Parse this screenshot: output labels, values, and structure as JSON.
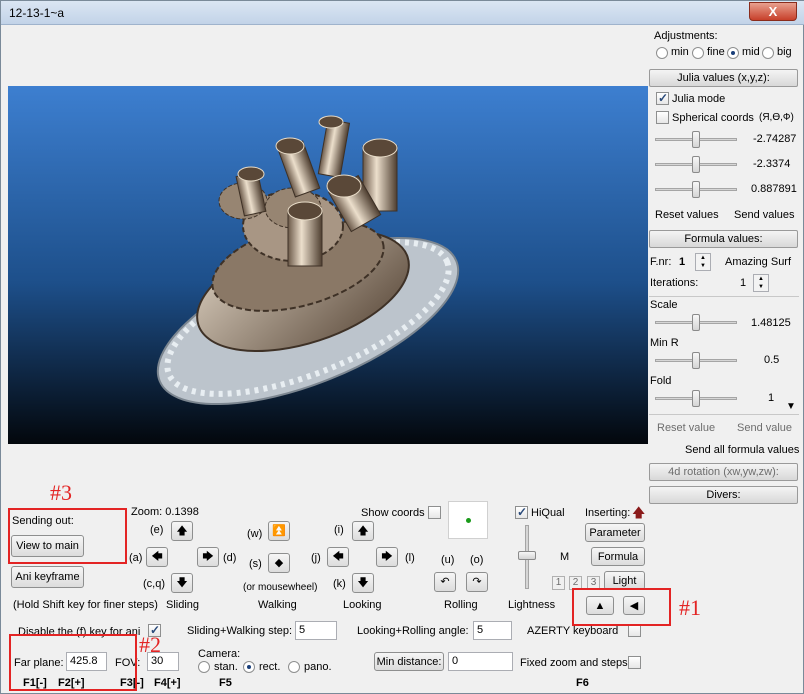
{
  "window": {
    "title": "12-13-1~a",
    "close": "X"
  },
  "adjust": {
    "label": "Adjustments:",
    "options": [
      "min",
      "fine",
      "mid",
      "big"
    ],
    "selected": "mid"
  },
  "julia": {
    "header": "Julia values (x,y,z):",
    "mode": "Julia mode",
    "spherical": "Spherical coords",
    "spherical_sym": "(Я,Ө,Ф)",
    "v1": "-2.74287",
    "v2": "-2.3374",
    "v3": "0.887891",
    "reset": "Reset values",
    "send": "Send values"
  },
  "formula": {
    "header": "Formula values:",
    "fnr_label": "F.nr:",
    "fnr": "1",
    "name": "Amazing Surf",
    "iter_label": "Iterations:",
    "iter": "1",
    "scale_label": "Scale",
    "scale": "1.48125",
    "minr_label": "Min R",
    "minr": "0.5",
    "fold_label": "Fold",
    "fold": "1",
    "reset": "Reset value",
    "send": "Send value",
    "send_all": "Send all formula values"
  },
  "rot4d": "4d rotation (xw,yw,zw):",
  "divers": "Divers:",
  "nav": {
    "zoom": "Zoom: 0.1398",
    "show_coords": "Show coords",
    "hiqual": "HiQual",
    "inserting": "Inserting:",
    "parameter": "Parameter",
    "formula": "Formula",
    "light": "Light",
    "m": "M",
    "n1": "1",
    "n2": "2",
    "n3": "3",
    "sending": "Sending out:",
    "view_main": "View to main",
    "ani": "Ani keyframe",
    "shift_hint": "(Hold Shift key for finer steps)",
    "k_e": "(e)",
    "k_a": "(a)",
    "k_d": "(d)",
    "k_cq": "(c,q)",
    "k_w": "(w)",
    "k_s": "(s)",
    "k_mw": "(or mousewheel)",
    "k_i": "(i)",
    "k_j": "(j)",
    "k_l": "(l)",
    "k_k": "(k)",
    "k_u": "(u)",
    "k_o": "(o)",
    "sliding": "Sliding",
    "walking": "Walking",
    "looking": "Looking",
    "rolling": "Rolling",
    "lightness": "Lightness"
  },
  "bottom": {
    "disable": "Disable the (f) key for ani",
    "sw_step": "Sliding+Walking step:",
    "sw_val": "5",
    "lr_angle": "Looking+Rolling angle:",
    "lr_val": "5",
    "azerty": "AZERTY keyboard",
    "far_plane": "Far plane:",
    "far_val": "425.8",
    "fov": "FOV:",
    "fov_val": "30",
    "camera": "Camera:",
    "stan": "stan.",
    "rect": "rect.",
    "pano": "pano.",
    "min_dist": "Min distance:",
    "min_val": "0",
    "fixed": "Fixed zoom and steps",
    "f1": "F1[-]",
    "f2": "F2[+]",
    "f3": "F3[-]",
    "f4": "F4[+]",
    "f5": "F5",
    "f6": "F6"
  },
  "annotations": {
    "a1": "#1",
    "a2": "#2",
    "a3": "#3"
  }
}
